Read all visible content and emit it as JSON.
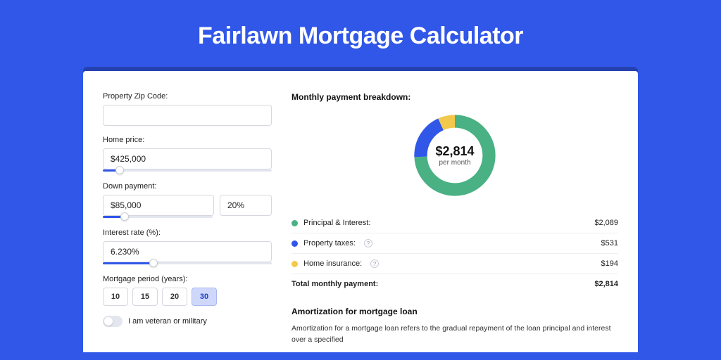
{
  "title": "Fairlawn Mortgage Calculator",
  "form": {
    "zip_label": "Property Zip Code:",
    "zip_value": "",
    "home_price_label": "Home price:",
    "home_price_value": "$425,000",
    "home_price_slider_pct": 10,
    "down_payment_label": "Down payment:",
    "down_payment_value": "$85,000",
    "down_payment_pct": "20%",
    "down_payment_slider_pct": 20,
    "interest_label": "Interest rate (%):",
    "interest_value": "6.230%",
    "interest_slider_pct": 30,
    "period_label": "Mortgage period (years):",
    "periods": [
      "10",
      "15",
      "20",
      "30"
    ],
    "period_active": "30",
    "veteran_label": "I am veteran or military",
    "veteran_on": false
  },
  "breakdown": {
    "title": "Monthly payment breakdown:",
    "donut_amount": "$2,814",
    "donut_sub": "per month",
    "rows": [
      {
        "color": "g",
        "label": "Principal & Interest:",
        "value": "$2,089",
        "help": false
      },
      {
        "color": "b",
        "label": "Property taxes:",
        "value": "$531",
        "help": true
      },
      {
        "color": "y",
        "label": "Home insurance:",
        "value": "$194",
        "help": true
      }
    ],
    "total_label": "Total monthly payment:",
    "total_value": "$2,814"
  },
  "amortization": {
    "title": "Amortization for mortgage loan",
    "text": "Amortization for a mortgage loan refers to the gradual repayment of the loan principal and interest over a specified"
  },
  "chart_data": {
    "type": "pie",
    "title": "Monthly payment breakdown",
    "series": [
      {
        "name": "Principal & Interest",
        "value": 2089,
        "color": "#49b183"
      },
      {
        "name": "Property taxes",
        "value": 531,
        "color": "#3157e8"
      },
      {
        "name": "Home insurance",
        "value": 194,
        "color": "#f2c94c"
      }
    ],
    "total": 2814,
    "center_label": "$2,814 per month"
  }
}
